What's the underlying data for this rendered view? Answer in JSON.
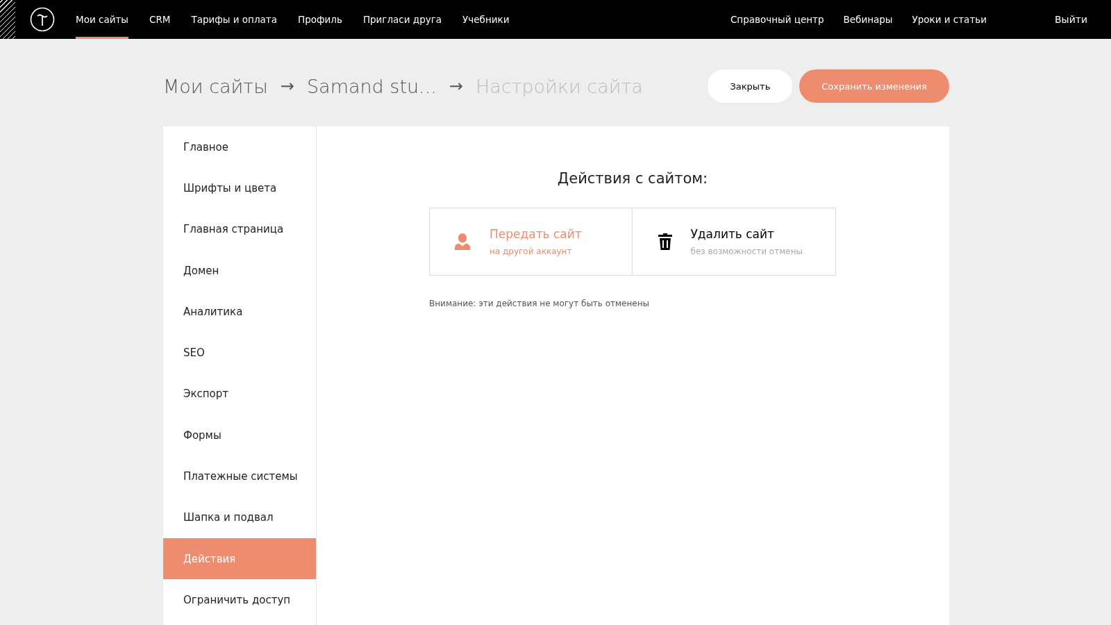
{
  "header": {
    "nav": [
      {
        "label": "Мои сайты",
        "selected": true
      },
      {
        "label": "CRM",
        "selected": false
      },
      {
        "label": "Тарифы и оплата",
        "selected": false
      },
      {
        "label": "Профиль",
        "selected": false
      },
      {
        "label": "Пригласи друга",
        "selected": false
      },
      {
        "label": "Учебники",
        "selected": false
      }
    ],
    "right_nav": [
      "Справочный центр",
      "Вебинары",
      "Уроки и статьи"
    ],
    "logout": "Выйти"
  },
  "breadcrumb": [
    {
      "label": "Мои сайты",
      "current": false
    },
    {
      "label": "Samand stu...",
      "current": false
    },
    {
      "label": "Настройки сайта",
      "current": true
    }
  ],
  "separator": "→",
  "buttons": [
    {
      "label": "Закрыть",
      "kind": "secondary"
    },
    {
      "label": "Сохранить изменения",
      "kind": "primary"
    }
  ],
  "sidebar": {
    "items": [
      {
        "label": "Главное",
        "selected": false
      },
      {
        "label": "Шрифты и цвета",
        "selected": false
      },
      {
        "label": "Главная страница",
        "selected": false
      },
      {
        "label": "Домен",
        "selected": false
      },
      {
        "label": "Аналитика",
        "selected": false
      },
      {
        "label": "SEO",
        "selected": false
      },
      {
        "label": "Экспорт",
        "selected": false
      },
      {
        "label": "Формы",
        "selected": false
      },
      {
        "label": "Платежные системы",
        "selected": false
      },
      {
        "label": "Шапка и подвал",
        "selected": false
      },
      {
        "label": "Действия",
        "selected": true
      },
      {
        "label": "Ограничить доступ",
        "selected": false
      }
    ]
  },
  "content": {
    "title": "Действия с сайтом:",
    "actions": [
      {
        "kind": "transfer",
        "title": "Передать сайт",
        "subtitle": "на другой аккаунт"
      },
      {
        "kind": "delete",
        "title": "Удалить сайт",
        "subtitle": "без возможности отмены"
      }
    ],
    "note": "Внимание: эти действия не могут быть отменены"
  }
}
